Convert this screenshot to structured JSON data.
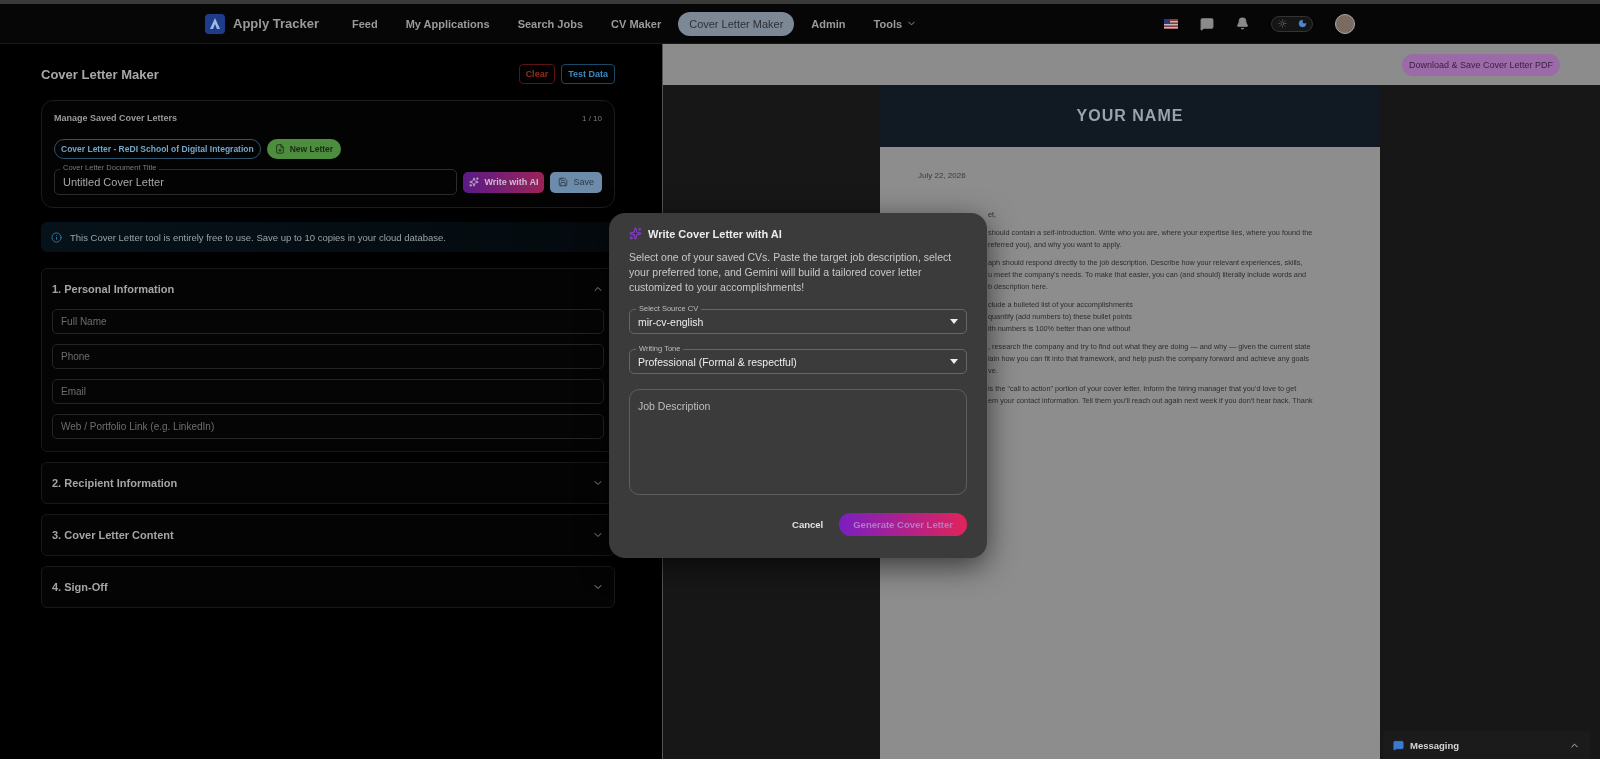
{
  "nav": {
    "brand": "Apply Tracker",
    "items": [
      {
        "label": "Feed",
        "selected": false
      },
      {
        "label": "My Applications",
        "selected": false
      },
      {
        "label": "Search Jobs",
        "selected": false
      },
      {
        "label": "CV Maker",
        "selected": false
      },
      {
        "label": "Cover Letter Maker",
        "selected": true
      },
      {
        "label": "Admin",
        "selected": false
      },
      {
        "label": "Tools",
        "selected": false,
        "kind": "menu"
      }
    ],
    "theme_toggle": {
      "dark": true
    }
  },
  "editor": {
    "title": "Cover Letter Maker",
    "actions": [
      {
        "label": "Clear",
        "kind": "danger"
      },
      {
        "label": "Test Data",
        "kind": "info"
      }
    ],
    "saved": {
      "title": "Manage Saved Cover Letters",
      "count": "1 / 10",
      "letters": [
        "Cover Letter - ReDI School of Digital Integration"
      ],
      "new_button": "New Letter",
      "title_field": {
        "label": "Cover Letter Document Title",
        "value": "Untitled Cover Letter"
      },
      "ai_button": "Write with AI",
      "save_button": "Save"
    },
    "info": "This Cover Letter tool is entirely free to use. Save up to 10 copies in your cloud database.",
    "sections": [
      {
        "title": "1. Personal Information",
        "expanded": true,
        "fields": [
          {
            "placeholder": "Full Name"
          },
          {
            "placeholder": "Phone"
          },
          {
            "placeholder": "Email"
          },
          {
            "placeholder": "Web / Portfolio Link (e.g. LinkedIn)"
          }
        ]
      },
      {
        "title": "2. Recipient Information",
        "expanded": false
      },
      {
        "title": "3. Cover Letter Content",
        "expanded": false
      },
      {
        "title": "4. Sign-Off",
        "expanded": false
      }
    ]
  },
  "preview": {
    "download_button": "Download & Save Cover Letter PDF",
    "name": "YOUR NAME",
    "date": "July 22, 2026",
    "paragraphs": [
      [
        "et,"
      ],
      [
        "should contain a self-introduction. Write who you are, where your expertise lies, where you found the",
        "referred you), and why you want to apply."
      ],
      [
        "aph should respond directly to the job description. Describe how your relevant experiences, skills,",
        "u meet the company's needs. To make that easier, you can (and should) literally include words and",
        "b description here."
      ],
      [
        "clude a bulleted list of your accomplishments",
        "quantify (add numbers to) these bullet points",
        "ith numbers is 100% better than one without"
      ],
      [
        ", research the company and try to find out what they are doing — and why — given the current state",
        "lain how you can fit into that framework, and help push the company forward and achieve any goals",
        "ve."
      ],
      [
        "is the “call to action” portion of your cover letter. Inform the hiring manager that you’d love to get",
        "em your contact information. Tell them you’ll reach out again next week if you don’t hear back. Thank"
      ]
    ]
  },
  "messaging": {
    "label": "Messaging"
  },
  "dialog": {
    "title": "Write Cover Letter with AI",
    "description": "Select one of your saved CVs. Paste the target job description, select your preferred tone, and Gemini will build a tailored cover letter customized to your accomplishments!",
    "selects": [
      {
        "label": "Select Source CV",
        "value": "mir-cv-english"
      },
      {
        "label": "Writing Tone",
        "value": "Professional (Formal & respectful)"
      }
    ],
    "job_description": {
      "placeholder": "Job Description"
    },
    "buttons": [
      {
        "label": "Cancel",
        "kind": "text"
      },
      {
        "label": "Generate Cover Letter",
        "kind": "primary",
        "disabled": true
      }
    ]
  }
}
